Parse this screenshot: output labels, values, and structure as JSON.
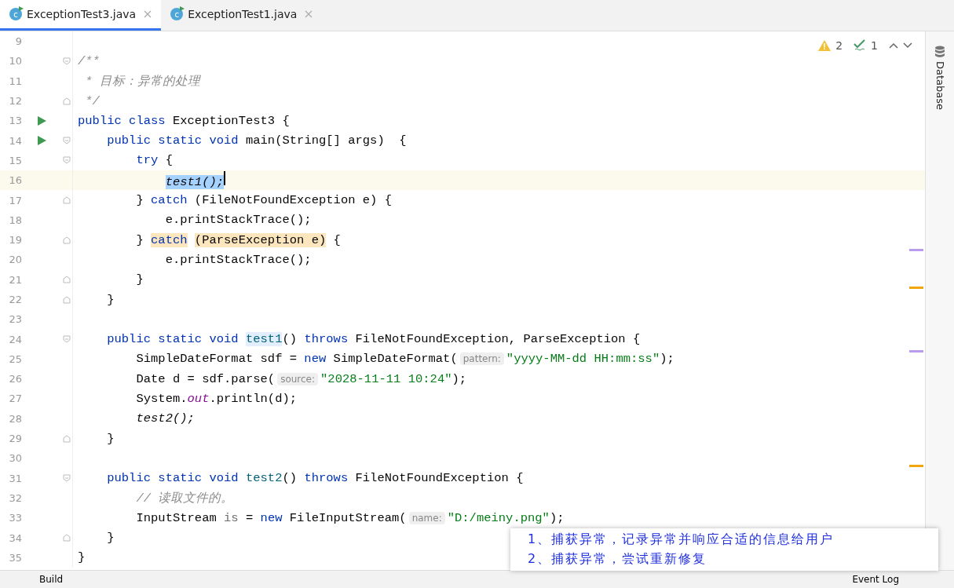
{
  "tabs": [
    {
      "label": "ExceptionTest3.java",
      "icon_label": "c",
      "selected": true
    },
    {
      "label": "ExceptionTest1.java",
      "icon_label": "c",
      "selected": false
    }
  ],
  "inspections": {
    "warnings": "2",
    "typos": "1"
  },
  "side_panel": {
    "label": "Database"
  },
  "lines": [
    {
      "number": "9",
      "current": false
    },
    {
      "number": "10",
      "current": false,
      "fold_marker": {
        "kind": "open"
      },
      "tokens": [
        {
          "text": "/**",
          "kind": "comment"
        }
      ]
    },
    {
      "number": "11",
      "current": false,
      "tokens": [
        {
          "text": " * 目标：异常的处理",
          "kind": "comment"
        }
      ]
    },
    {
      "number": "12",
      "current": false,
      "fold_marker": {
        "kind": "close"
      },
      "tokens": [
        {
          "text": " */",
          "kind": "comment"
        }
      ]
    },
    {
      "number": "13",
      "current": false,
      "gutter_icon": {
        "kind": "run"
      },
      "tokens": [
        {
          "text": "public class",
          "kind": "kw"
        },
        {
          "text": " ExceptionTest3 {",
          "kind": "plain"
        }
      ]
    },
    {
      "number": "14",
      "current": false,
      "gutter_icon": {
        "kind": "run"
      },
      "fold_marker": {
        "kind": "open"
      },
      "tokens": [
        {
          "text": "    public static void",
          "kind": "kw"
        },
        {
          "text": " main(String[] args)  {",
          "kind": "plain"
        }
      ]
    },
    {
      "number": "15",
      "current": false,
      "fold_marker": {
        "kind": "open"
      },
      "tokens": [
        {
          "text": "        try",
          "kind": "kw"
        },
        {
          "text": " {",
          "kind": "plain"
        }
      ]
    },
    {
      "number": "16",
      "current": true,
      "tokens": [
        {
          "text": "            test1();",
          "kind": "selected"
        }
      ]
    },
    {
      "number": "17",
      "current": false,
      "fold_marker": {
        "kind": "close"
      },
      "tokens": [
        {
          "text": "        } ",
          "kind": "plain"
        },
        {
          "text": "catch",
          "kind": "kw"
        },
        {
          "text": " (FileNotFoundException e) {",
          "kind": "plain"
        }
      ]
    },
    {
      "number": "18",
      "current": false,
      "tokens": [
        {
          "text": "            e.printStackTrace();",
          "kind": "plain"
        }
      ]
    },
    {
      "number": "19",
      "current": false,
      "fold_marker": {
        "kind": "close"
      },
      "tokens": [
        {
          "text": "        } ",
          "kind": "plain"
        },
        {
          "text": "catch",
          "kind": "kw_warn"
        },
        {
          "text": " (ParseException e)",
          "kind": "warn"
        },
        {
          "text": " {",
          "kind": "plain"
        }
      ]
    },
    {
      "number": "20",
      "current": false,
      "tokens": [
        {
          "text": "            e.printStackTrace();",
          "kind": "plain"
        }
      ]
    },
    {
      "number": "21",
      "current": false,
      "fold_marker": {
        "kind": "close"
      },
      "tokens": [
        {
          "text": "        }",
          "kind": "plain"
        }
      ]
    },
    {
      "number": "22",
      "current": false,
      "fold_marker": {
        "kind": "close"
      },
      "tokens": [
        {
          "text": "    }",
          "kind": "plain"
        }
      ]
    },
    {
      "number": "23",
      "current": false
    },
    {
      "number": "24",
      "current": false,
      "fold_marker": {
        "kind": "open"
      },
      "tokens": [
        {
          "text": "    public static void ",
          "kind": "kw"
        },
        {
          "text": "test1",
          "kind": "decl_hl"
        },
        {
          "text": "()",
          "kind": "plain"
        },
        {
          "text": " throws",
          "kind": "kw"
        },
        {
          "text": " FileNotFoundException, ParseException {",
          "kind": "plain"
        }
      ]
    },
    {
      "number": "25",
      "current": false,
      "tokens": [
        {
          "text": "        SimpleDateFormat sdf = ",
          "kind": "plain"
        },
        {
          "text": "new",
          "kind": "kw"
        },
        {
          "text": " SimpleDateFormat(",
          "kind": "plain"
        },
        {
          "text": "pattern:",
          "kind": "hint"
        },
        {
          "text": "\"yyyy-MM-dd HH:mm:ss\"",
          "kind": "str"
        },
        {
          "text": ");",
          "kind": "plain"
        }
      ]
    },
    {
      "number": "26",
      "current": false,
      "tokens": [
        {
          "text": "        Date d = sdf.parse(",
          "kind": "plain"
        },
        {
          "text": "source:",
          "kind": "hint"
        },
        {
          "text": "\"2028-11-11 10:24\"",
          "kind": "str"
        },
        {
          "text": ");",
          "kind": "plain"
        }
      ]
    },
    {
      "number": "27",
      "current": false,
      "tokens": [
        {
          "text": "        System.",
          "kind": "plain"
        },
        {
          "text": "out",
          "kind": "field"
        },
        {
          "text": ".println(d);",
          "kind": "plain"
        }
      ]
    },
    {
      "number": "28",
      "current": false,
      "tokens": [
        {
          "text": "        test2();",
          "kind": "italic"
        }
      ]
    },
    {
      "number": "29",
      "current": false,
      "fold_marker": {
        "kind": "close"
      },
      "tokens": [
        {
          "text": "    }",
          "kind": "plain"
        }
      ]
    },
    {
      "number": "30",
      "current": false
    },
    {
      "number": "31",
      "current": false,
      "fold_marker": {
        "kind": "open"
      },
      "tokens": [
        {
          "text": "    public static void ",
          "kind": "kw"
        },
        {
          "text": "test2",
          "kind": "decl"
        },
        {
          "text": "()",
          "kind": "plain"
        },
        {
          "text": " throws",
          "kind": "kw"
        },
        {
          "text": " FileNotFoundException {",
          "kind": "plain"
        }
      ]
    },
    {
      "number": "32",
      "current": false,
      "tokens": [
        {
          "text": "        // 读取文件的。",
          "kind": "comment"
        }
      ]
    },
    {
      "number": "33",
      "current": false,
      "tokens": [
        {
          "text": "        InputStream ",
          "kind": "plain"
        },
        {
          "text": "is",
          "kind": "unused"
        },
        {
          "text": " = ",
          "kind": "plain"
        },
        {
          "text": "new",
          "kind": "kw"
        },
        {
          "text": " FileInputStream(",
          "kind": "plain"
        },
        {
          "text": "name:",
          "kind": "hint"
        },
        {
          "text": "\"D:/meiny.png\"",
          "kind": "str"
        },
        {
          "text": ");",
          "kind": "plain"
        }
      ]
    },
    {
      "number": "34",
      "current": false,
      "fold_marker": {
        "kind": "close"
      },
      "tokens": [
        {
          "text": "    }",
          "kind": "plain"
        }
      ]
    },
    {
      "number": "35",
      "current": false,
      "tokens": [
        {
          "text": "}",
          "kind": "plain"
        }
      ]
    }
  ],
  "annotation": {
    "lines": [
      "1、捕获异常，记录异常并响应合适的信息给用户",
      "2、捕获异常，尝试重新修复"
    ]
  },
  "bottom_bar": {
    "left": "Build",
    "right": "Event Log"
  }
}
